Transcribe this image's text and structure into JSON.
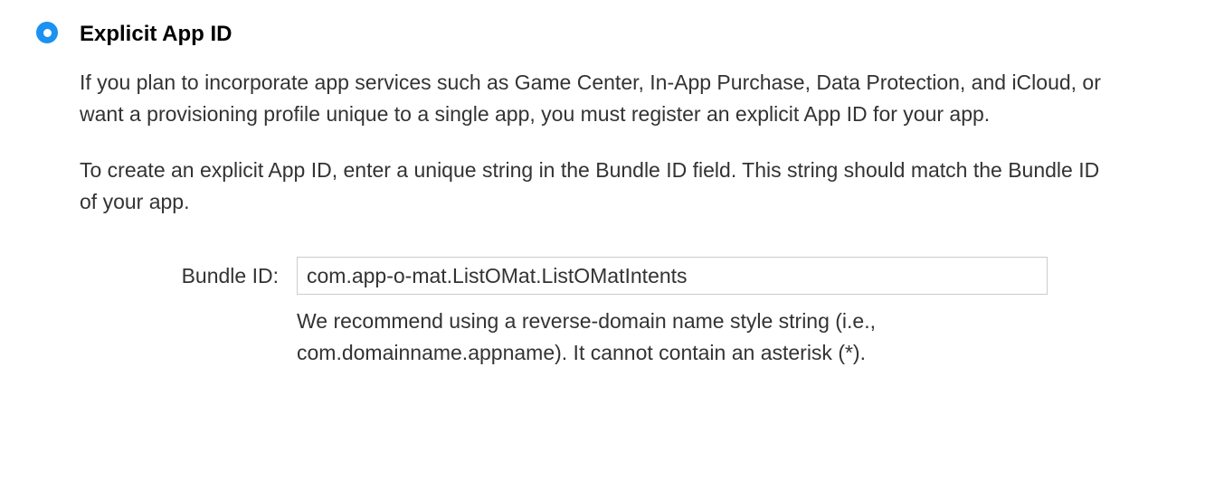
{
  "option": {
    "title": "Explicit App ID",
    "paragraph1": "If you plan to incorporate app services such as Game Center, In-App Purchase, Data Protection, and iCloud, or want a provisioning profile unique to a single app, you must register an explicit App ID for your app.",
    "paragraph2": "To create an explicit App ID, enter a unique string in the Bundle ID field. This string should match the Bundle ID of your app."
  },
  "field": {
    "label": "Bundle ID:",
    "value": "com.app-o-mat.ListOMat.ListOMatIntents",
    "hint": "We recommend using a reverse-domain name style string (i.e., com.domainname.appname). It cannot contain an asterisk (*)."
  }
}
